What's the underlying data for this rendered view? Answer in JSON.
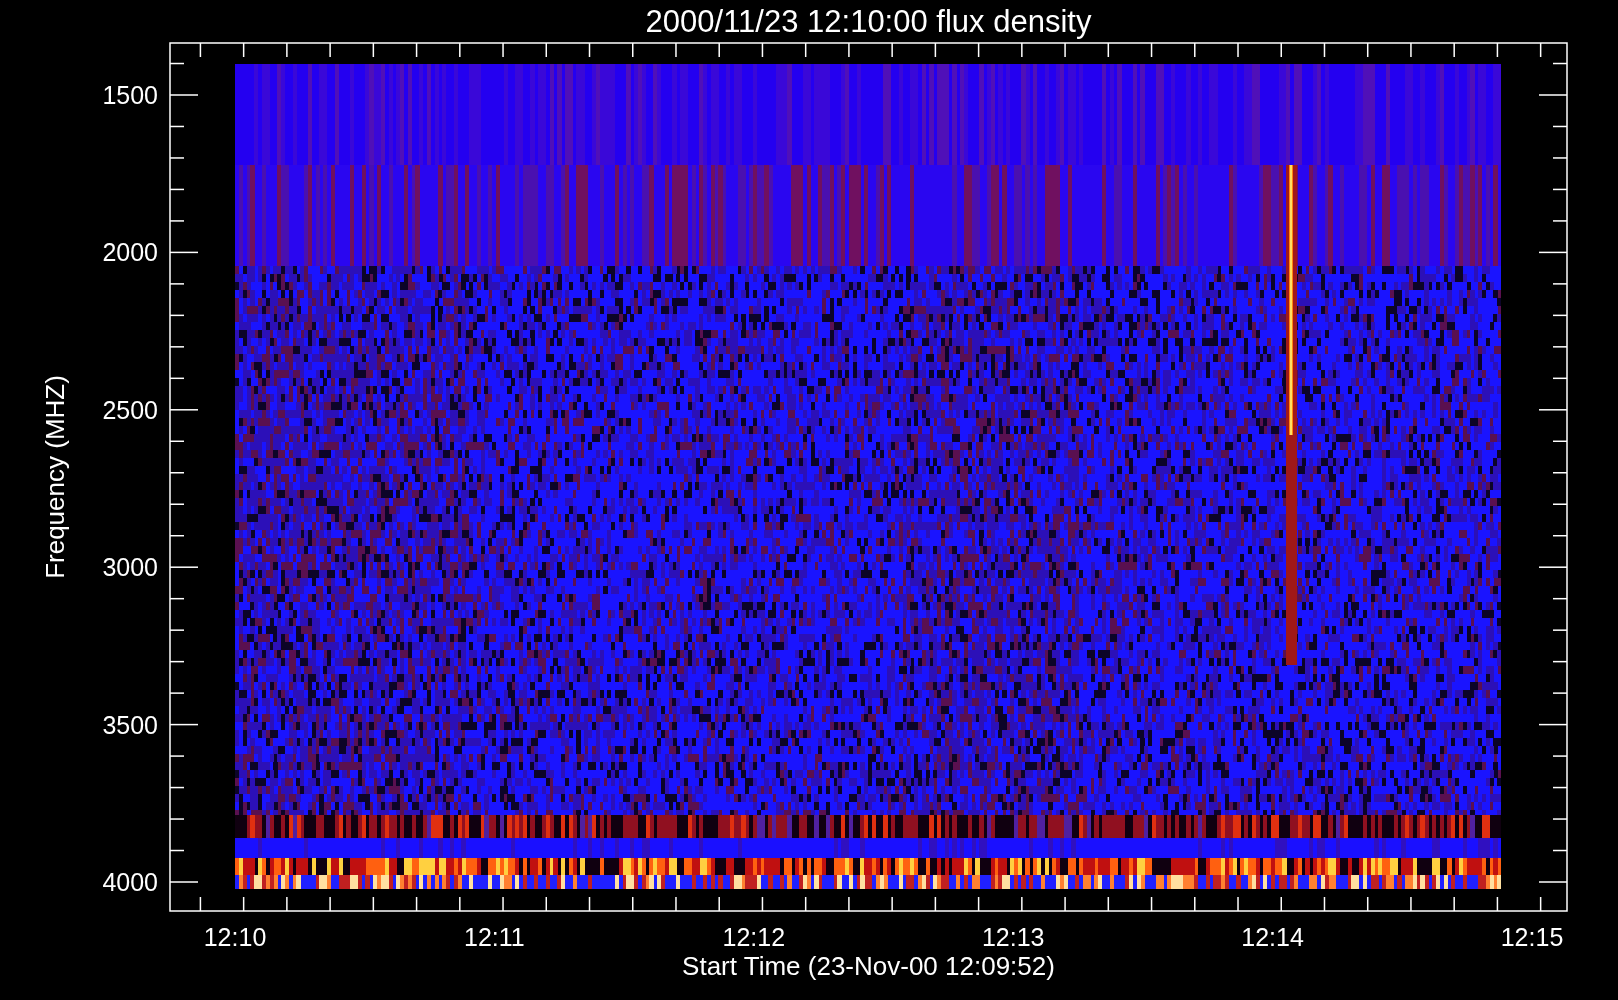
{
  "plot": {
    "title": "2000/11/23 12:10:00 flux density",
    "xlabel": "Start Time (23-Nov-00 12:09:52)",
    "ylabel": "Frequency (MHZ)",
    "xticks": [
      "12:10",
      "12:11",
      "12:12",
      "12:13",
      "12:14",
      "12:15"
    ],
    "yticks": [
      "1500",
      "2000",
      "2500",
      "3000",
      "3500",
      "4000"
    ]
  }
}
